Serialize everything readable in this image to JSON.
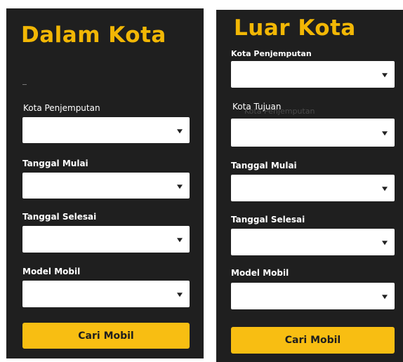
{
  "dalam_kota": {
    "title": "Dalam Kota",
    "fields": {
      "kota_penjemputan": "Kota Penjemputan",
      "tanggal_mulai": "Tanggal Mulai",
      "tanggal_selesai": "Tanggal Selesai",
      "model_mobil": "Model Mobil"
    },
    "button": "Cari Mobil"
  },
  "luar_kota": {
    "title": "Luar Kota",
    "fields": {
      "kota_penjemputan": "Kota Penjemputan",
      "kota_tujuan": "Kota Tujuan",
      "tanggal_mulai": "Tanggal Mulai",
      "tanggal_selesai": "Tanggal Selesai",
      "model_mobil": "Model Mobil"
    },
    "button": "Cari Mobil"
  },
  "colors": {
    "panel_background": "#1f1f1f",
    "accent": "#f2b705",
    "button": "#f8be12"
  },
  "icons": {
    "dropdown": "caret-down-icon"
  }
}
